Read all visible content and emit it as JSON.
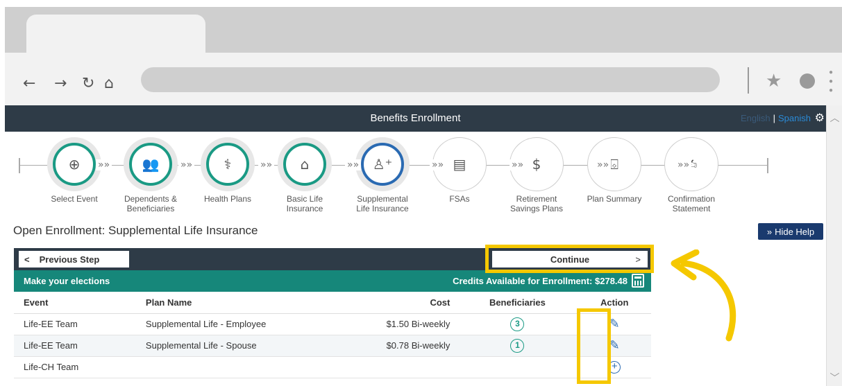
{
  "app": {
    "title": "Benefits Enrollment",
    "lang_english": "English",
    "lang_sep": "|",
    "lang_spanish": "Spanish"
  },
  "steps": [
    {
      "label1": "Select Event",
      "label2": "",
      "icon": "plus-icon",
      "glyph": "⊕",
      "state": "done"
    },
    {
      "label1": "Dependents &",
      "label2": "Beneficiaries",
      "icon": "people-icon",
      "glyph": "👥",
      "state": "done"
    },
    {
      "label1": "Health Plans",
      "label2": "",
      "icon": "stethoscope-icon",
      "glyph": "⚕",
      "state": "done"
    },
    {
      "label1": "Basic Life",
      "label2": "Insurance",
      "icon": "house-doc-icon",
      "glyph": "⌂",
      "state": "done"
    },
    {
      "label1": "Supplemental",
      "label2": "Life Insurance",
      "icon": "add-person-icon",
      "glyph": "♙⁺",
      "state": "current"
    },
    {
      "label1": "FSAs",
      "label2": "",
      "icon": "wallet-icon",
      "glyph": "▤",
      "state": "todo"
    },
    {
      "label1": "Retirement",
      "label2": "Savings Plans",
      "icon": "money-bag-icon",
      "glyph": "$",
      "state": "todo"
    },
    {
      "label1": "Plan Summary",
      "label2": "",
      "icon": "chart-plus-icon",
      "glyph": "⌺",
      "state": "todo"
    },
    {
      "label1": "Confirmation",
      "label2": "Statement",
      "icon": "signed-doc-icon",
      "glyph": "✍",
      "state": "todo"
    }
  ],
  "page": {
    "title": "Open Enrollment: Supplemental Life Insurance",
    "hide_help": "Hide Help"
  },
  "nav": {
    "previous": "Previous Step",
    "continue": "Continue"
  },
  "elections": {
    "title": "Make your elections",
    "credits": "Credits Available for Enrollment: $278.48"
  },
  "table": {
    "headers": [
      "Event",
      "Plan Name",
      "Cost",
      "Beneficiaries",
      "Action"
    ],
    "rows": [
      {
        "event": "Life-EE Team",
        "plan": "Supplemental Life - Employee",
        "cost": "$1.50 Bi-weekly",
        "beneficiaries": "3",
        "action": "edit"
      },
      {
        "event": "Life-EE Team",
        "plan": "Supplemental Life - Spouse",
        "cost": "$0.78 Bi-weekly",
        "beneficiaries": "1",
        "action": "edit"
      },
      {
        "event": "Life-CH Team",
        "plan": "",
        "cost": "",
        "beneficiaries": "",
        "action": "add"
      }
    ]
  },
  "colors": {
    "header_bg": "#2e3b47",
    "teal": "#16877a",
    "highlight": "#f5c800",
    "accent_blue": "#2a6ab2"
  }
}
